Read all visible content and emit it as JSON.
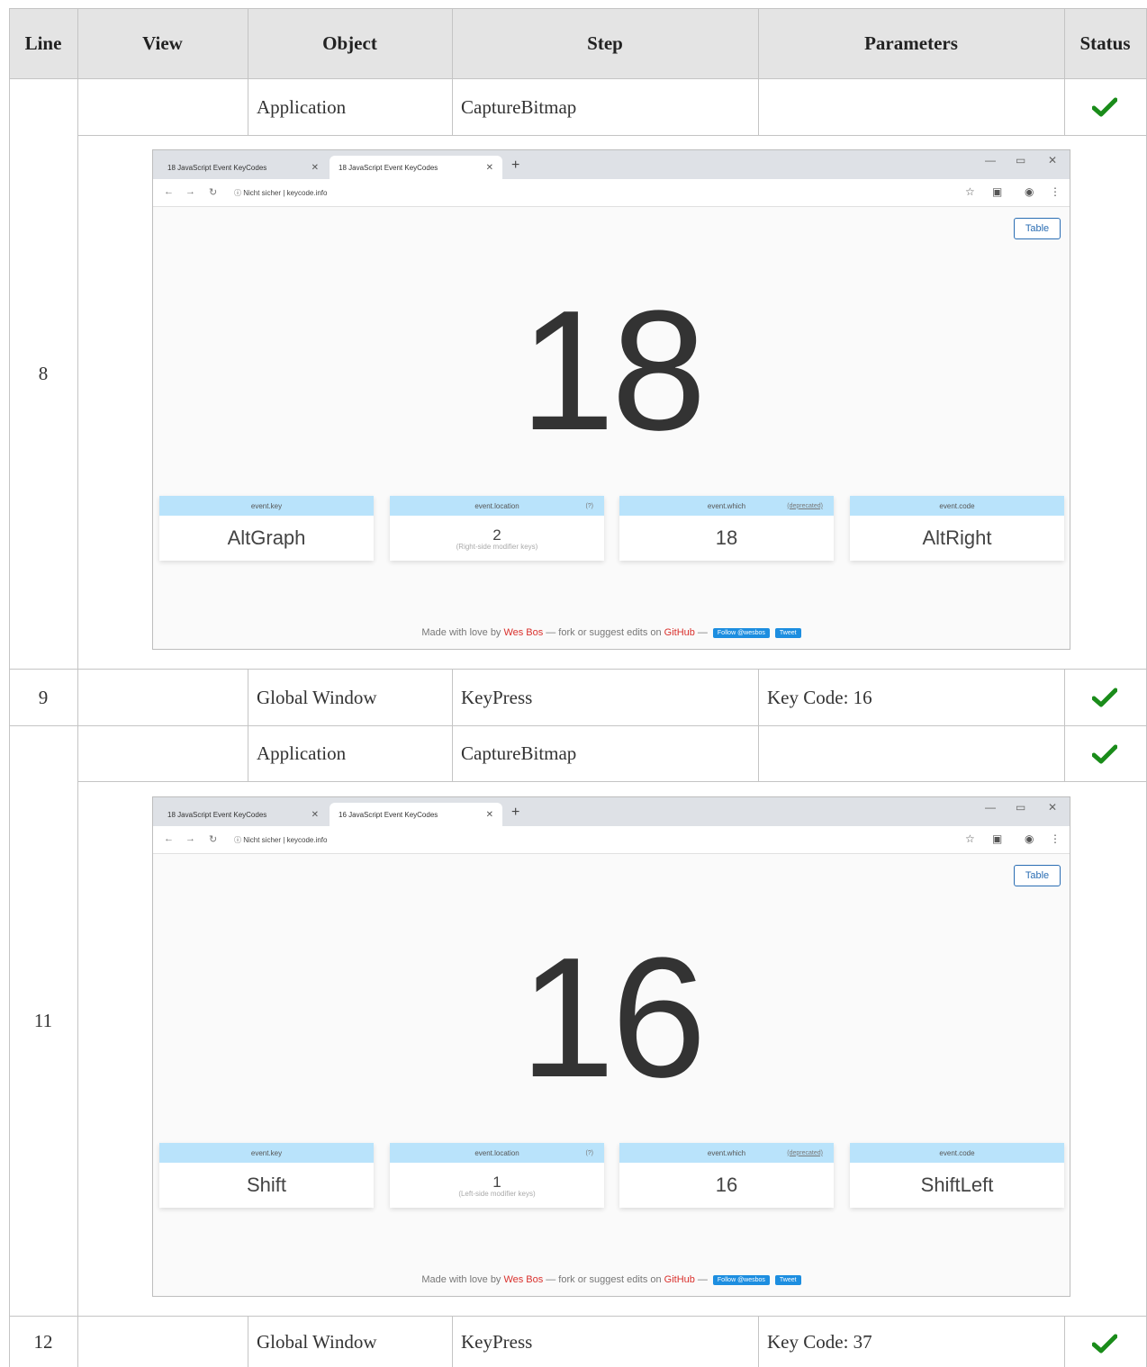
{
  "headers": {
    "line": "Line",
    "view": "View",
    "object": "Object",
    "step": "Step",
    "parameters": "Parameters",
    "status": "Status"
  },
  "rows": [
    {
      "line": "8",
      "view": "",
      "object": "Application",
      "step": "CaptureBitmap",
      "parameters": "",
      "status": "passed"
    },
    {
      "line": "9",
      "view": "",
      "object": "Global Window",
      "step": "KeyPress",
      "parameters": "Key Code: 16",
      "status": "passed"
    },
    {
      "line": "11",
      "view": "",
      "object": "Application",
      "step": "CaptureBitmap",
      "parameters": "",
      "status": "passed"
    },
    {
      "line": "12",
      "view": "",
      "object": "Global Window",
      "step": "KeyPress",
      "parameters": "Key Code: 37",
      "status": "passed"
    }
  ],
  "colors": {
    "header_bg": "#e4e4e4",
    "check": "#1a8c1a",
    "card_head": "#b9e3fb",
    "link_red": "#d9302c",
    "table_btn": "#2a6db3"
  },
  "shot1": {
    "tab1": "18 JavaScript Event KeyCodes",
    "tab2": "18 JavaScript Event KeyCodes",
    "address_prefix": "Nicht sicher |",
    "address": "keycode.info",
    "table_button": "Table",
    "big_number": "18",
    "cards": [
      {
        "head": "event.key",
        "aux": "",
        "value": "AltGraph",
        "note": ""
      },
      {
        "head": "event.location",
        "aux": "(?)",
        "value": "2",
        "note": "(Right-side modifier keys)"
      },
      {
        "head": "event.which",
        "aux": "(deprecated)",
        "value": "18",
        "note": ""
      },
      {
        "head": "event.code",
        "aux": "",
        "value": "AltRight",
        "note": ""
      }
    ],
    "footer": {
      "text1": "Made with love by",
      "author": "Wes Bos",
      "text2": "— fork or suggest edits on",
      "github": "GitHub",
      "dash": "—",
      "follow": "Follow @wesbos",
      "tweet": "Tweet"
    }
  },
  "shot2": {
    "tab1": "18 JavaScript Event KeyCodes",
    "tab2": "16 JavaScript Event KeyCodes",
    "address_prefix": "Nicht sicher |",
    "address": "keycode.info",
    "table_button": "Table",
    "big_number": "16",
    "cards": [
      {
        "head": "event.key",
        "aux": "",
        "value": "Shift",
        "note": ""
      },
      {
        "head": "event.location",
        "aux": "(?)",
        "value": "1",
        "note": "(Left-side modifier keys)"
      },
      {
        "head": "event.which",
        "aux": "(deprecated)",
        "value": "16",
        "note": ""
      },
      {
        "head": "event.code",
        "aux": "",
        "value": "ShiftLeft",
        "note": ""
      }
    ],
    "footer": {
      "text1": "Made with love by",
      "author": "Wes Bos",
      "text2": "— fork or suggest edits on",
      "github": "GitHub",
      "dash": "—",
      "follow": "Follow @wesbos",
      "tweet": "Tweet"
    }
  }
}
